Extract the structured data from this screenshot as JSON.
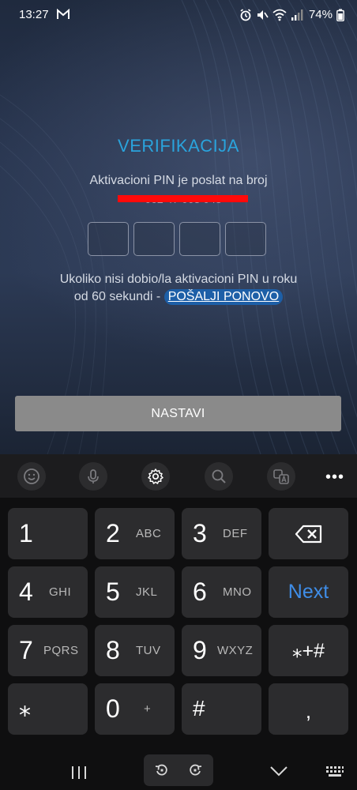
{
  "status_bar": {
    "time": "13:27",
    "battery": "74%"
  },
  "verification": {
    "title": "VERIFIKACIJA",
    "subtitle": "Aktivacioni PIN je poslat na broj",
    "phone_number": "062 47 003 048",
    "pin_boxes": [
      "",
      "",
      "",
      ""
    ],
    "resend_line1": "Ukoliko nisi dobio/la aktivacioni PIN u roku",
    "resend_line2": "od 60 sekundi -",
    "resend_link": "POŠALJI PONOVO",
    "continue_button": "NASTAVI"
  },
  "colors": {
    "title": "#2aa3dc",
    "redaction": "#ff0a0a",
    "next_key": "#3f8de7"
  },
  "keyboard": {
    "toolbar": [
      "emoji-icon",
      "microphone-icon",
      "settings-icon",
      "search-icon",
      "translate-icon",
      "more-icon"
    ],
    "keys": {
      "k1": {
        "digit": "1",
        "letters": ""
      },
      "k2": {
        "digit": "2",
        "letters": "ABC"
      },
      "k3": {
        "digit": "3",
        "letters": "DEF"
      },
      "k4": {
        "digit": "4",
        "letters": "GHI"
      },
      "k5": {
        "digit": "5",
        "letters": "JKL"
      },
      "k6": {
        "digit": "6",
        "letters": "MNO"
      },
      "k7": {
        "digit": "7",
        "letters": "PQRS"
      },
      "k8": {
        "digit": "8",
        "letters": "TUV"
      },
      "k9": {
        "digit": "9",
        "letters": "WXYZ"
      },
      "k0": {
        "digit": "0",
        "letters": "+"
      },
      "star": "⁎",
      "hash": "#",
      "comma": ",",
      "symbols": "⁎+#",
      "next": "Next"
    }
  },
  "navigation_bar": [
    "recents-icon",
    "rotate-left-icon",
    "rotate-right-icon",
    "hide-keyboard-icon",
    "keyboard-icon"
  ]
}
